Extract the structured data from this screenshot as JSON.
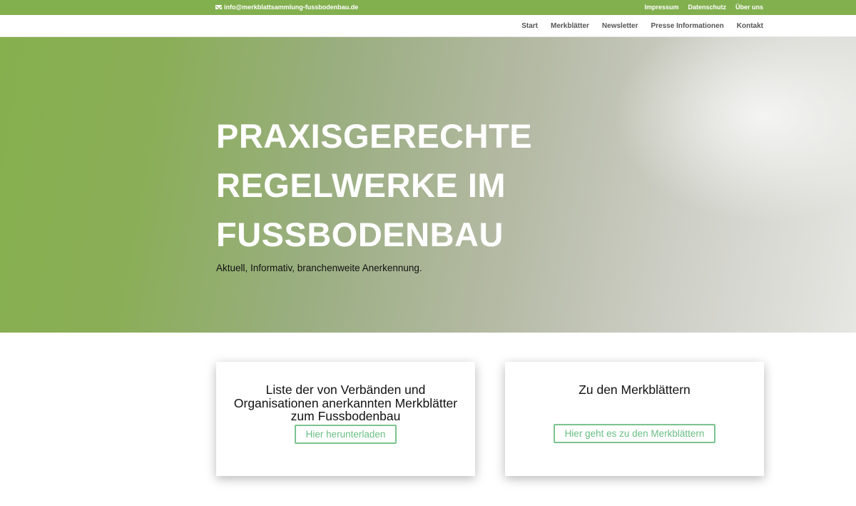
{
  "topbar": {
    "email": "info@merkblattsammlung-fussbodenbau.de",
    "links": [
      "Impressum",
      "Datenschutz",
      "Über uns"
    ]
  },
  "nav": {
    "items": [
      "Start",
      "Merkblätter",
      "Newsletter",
      "Presse Informationen",
      "Kontakt"
    ]
  },
  "hero": {
    "title_lines": [
      "PRAXISGERECHTE",
      "REGELWERKE IM",
      "FUSSBODENBAU"
    ],
    "subtitle": "Aktuell, Informativ, branchenweite Anerkennung."
  },
  "cards": [
    {
      "title": "Liste der von Verbänden und Organisationen anerkannten Merkblätter zum Fussbodenbau",
      "button": "Hier herunterladen"
    },
    {
      "title": "Zu den Merkblättern",
      "button": "Hier geht es zu den Merkblättern"
    }
  ],
  "colors": {
    "brand_green": "#82b04f",
    "button_green": "#7cc38f"
  }
}
